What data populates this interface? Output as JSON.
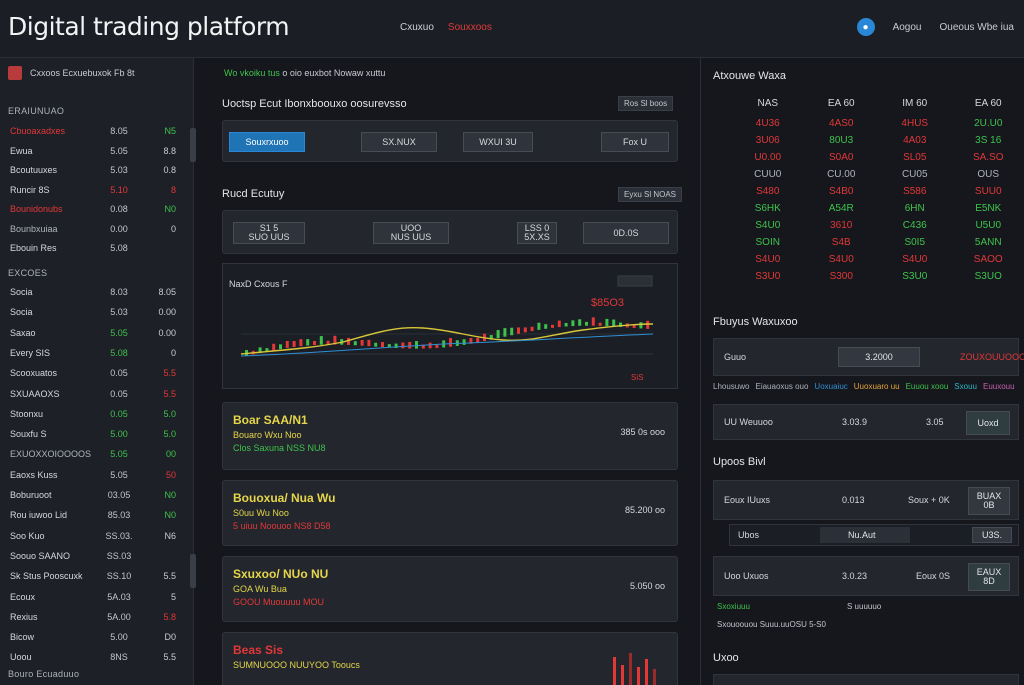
{
  "header": {
    "title": "Digital trading platform",
    "nav": [
      "Cxuxuo",
      "Souxxoos"
    ],
    "right_links": [
      "Aogou",
      "Oueous Wbe iua"
    ],
    "user_icon": "user-icon"
  },
  "sidebar": {
    "head": "Cxxoos  Ecxuebuxok  Fb  8t",
    "section1": "ERAIUNUAO",
    "rows1": [
      {
        "name": "Cbuoaxadxes",
        "val": "8.05",
        "chg": "N5",
        "name_color": "red",
        "chg_color": "green"
      },
      {
        "name": "Ewua",
        "val": "5.05",
        "chg": "8.8",
        "name_color": "",
        "chg_color": ""
      },
      {
        "name": "Bcoutuuxes",
        "val": "5.03",
        "chg": "0.8",
        "name_color": "",
        "chg_color": ""
      },
      {
        "name": "Runcir 8S",
        "val": "5.10",
        "chg": "8",
        "name_color": "",
        "chg_color": "red",
        "val_color": "red"
      },
      {
        "name": "Bounidonubs",
        "val": "0.08",
        "chg": "N0",
        "name_color": "red",
        "chg_color": "green"
      },
      {
        "name": "Bounbxuiaa",
        "val": "0.00",
        "chg": "0",
        "name_color": "muted",
        "chg_color": ""
      },
      {
        "name": "Ebouin Res",
        "val": "5.08",
        "chg": "",
        "name_color": "",
        "chg_color": ""
      }
    ],
    "section2": "EXCOES",
    "rows2": [
      {
        "name": "Socia",
        "val": "8.03",
        "chg": "8.05",
        "val_color": "",
        "chg_color": ""
      },
      {
        "name": "Socia",
        "val": "5.03",
        "chg": "0.00",
        "val_color": "",
        "chg_color": ""
      },
      {
        "name": "Saxao",
        "val": "5.05",
        "chg": "0.00",
        "val_color": "green",
        "chg_color": ""
      },
      {
        "name": "Every SIS",
        "val": "5.08",
        "chg": "0",
        "val_color": "green",
        "chg_color": ""
      },
      {
        "name": "Scooxuatos",
        "val": "0.05",
        "chg": "5.5",
        "val_color": "",
        "chg_color": "red"
      },
      {
        "name": "SXUAAOXS",
        "val": "0.05",
        "chg": "5.5",
        "val_color": "",
        "chg_color": "red"
      },
      {
        "name": "Stoonxu",
        "val": "0.05",
        "chg": "5.0",
        "val_color": "green",
        "chg_color": "green"
      },
      {
        "name": "Souxfu S",
        "val": "5.00",
        "chg": "5.0",
        "val_color": "green",
        "chg_color": "green"
      },
      {
        "name": "EXUOXXOIOOOOS",
        "val": "5.05",
        "chg": "00",
        "val_color": "green",
        "chg_color": "green",
        "name_color": "muted"
      },
      {
        "name": "Eaoxs Kuss",
        "val": "5.05",
        "chg": "50",
        "val_color": "",
        "chg_color": "red"
      },
      {
        "name": "Boburuoot",
        "val": "03.05",
        "chg": "N0",
        "val_color": "",
        "chg_color": "green"
      },
      {
        "name": "Rou iuwoo Lid",
        "val": "85.03",
        "chg": "N0",
        "val_color": "",
        "chg_color": "green"
      },
      {
        "name": "Soo Kuo",
        "val": "SS.03.",
        "chg": "N6",
        "val_color": "",
        "chg_color": ""
      },
      {
        "name": "Soouo SAANO",
        "val": "SS.03",
        "chg": "",
        "val_color": "",
        "chg_color": ""
      },
      {
        "name": "Sk Stus Pooscuxk",
        "val": "SS.10",
        "chg": "5.5",
        "val_color": "",
        "chg_color": ""
      },
      {
        "name": "Ecoux",
        "val": "5A.03",
        "chg": "5",
        "val_color": "",
        "chg_color": ""
      },
      {
        "name": "Rexius",
        "val": "5A.00",
        "chg": "5.8",
        "val_color": "",
        "chg_color": "red"
      },
      {
        "name": "Bicow",
        "val": "5.00",
        "chg": "D0",
        "val_color": "",
        "chg_color": ""
      },
      {
        "name": "Uoou",
        "val": "8NS",
        "chg": "5.5",
        "val_color": "",
        "chg_color": ""
      }
    ],
    "footer": "Bouro Ecuaduuo"
  },
  "main": {
    "ticker_green": "Wo vkoiku tus",
    "ticker_rest": "o oio euxbot Nowaw xuttu",
    "section1": {
      "title": "Uoctsp Ecut Ibonxboouxo oosurevsso",
      "pill": "Ros  Sl boos",
      "buttons": [
        "Souxrxuoo",
        "SX.NUX",
        "WXUI 3U",
        "Fox U"
      ]
    },
    "section2": {
      "title": "Rucd Ecutuy",
      "pill": "Eyxu  Sl NOAS",
      "buttons": [
        "S1 5\nSUO UUS",
        "UOO\nNUS UUS",
        "LSS 0\n5X.XS",
        "0D.0S"
      ]
    },
    "chart": {
      "title": "NaxD Cxous F",
      "price_label": "$85O3",
      "corner_label": "",
      "bottom_right": "SiS"
    },
    "orders": [
      {
        "t1": "Boar SAA/N1",
        "t2": "Bouaro Wxu Noo",
        "t3": "Clos Saxuna  NSS NU8",
        "amt": "385 0s  ooo",
        "t3_color": "green"
      },
      {
        "t1": "Bouoxua/ Nua Wu",
        "t2": "S0uu  Wu Noo",
        "t3": "5 uiuu  Noouoo NS8 D58",
        "amt": "85.200  oo",
        "t3_color": "red"
      },
      {
        "t1": "Sxuxoo/ NUo NU",
        "t2": "GOA  Wu  Bua",
        "t3": "GOOU  Muouuuu  MOU",
        "amt": "5.050  oo",
        "t3_color": "red"
      },
      {
        "t1": "Beas Sis",
        "t2": "SUMNUOOO  NUUYOO  Tooucs",
        "t3": "",
        "amt": "",
        "t3_color": "",
        "t1_color": "red"
      }
    ]
  },
  "right": {
    "market_title": "Atxouwe Waxa",
    "matrix_head": [
      "NAS",
      "EA 60",
      "IM 60",
      "EA 60"
    ],
    "matrix_rows": [
      {
        "cells": [
          "4U36",
          "4AS0",
          "4HUS",
          "2U.U0"
        ],
        "colors": [
          "red",
          "red",
          "red",
          "green"
        ]
      },
      {
        "cells": [
          "3U06",
          "80U3",
          "4A03",
          "3S 16"
        ],
        "colors": [
          "red",
          "green",
          "red",
          "green"
        ]
      },
      {
        "cells": [
          "U0.00",
          "S0A0",
          "SL05",
          "SA.SO"
        ],
        "colors": [
          "red",
          "red",
          "red",
          "red"
        ]
      },
      {
        "cells": [
          "CUU0",
          "CU.00",
          "CU05",
          "OUS"
        ],
        "colors": [
          "muted",
          "muted",
          "muted",
          "muted"
        ]
      },
      {
        "cells": [
          "S480",
          "S4B0",
          "S586",
          "SUU0"
        ],
        "colors": [
          "red",
          "red",
          "red",
          "red"
        ]
      },
      {
        "cells": [
          "S6HK",
          "A54R",
          "6HN",
          "E5NK"
        ],
        "colors": [
          "green",
          "green",
          "green",
          "green"
        ]
      },
      {
        "cells": [
          "S4U0",
          "3610",
          "C436",
          "U5U0"
        ],
        "colors": [
          "green",
          "red",
          "green",
          "green"
        ]
      },
      {
        "cells": [
          "SOIN",
          "S4B",
          "S0I5",
          "5ANN"
        ],
        "colors": [
          "green",
          "red",
          "green",
          "green"
        ]
      },
      {
        "cells": [
          "S4U0",
          "S4U0",
          "S4U0",
          "SAOO"
        ],
        "colors": [
          "red",
          "red",
          "red",
          "red"
        ]
      },
      {
        "cells": [
          "S3U0",
          "S300",
          "S3U0",
          "S3UO"
        ],
        "colors": [
          "red",
          "red",
          "green",
          "green"
        ]
      }
    ],
    "market2_title": "Fbuyus Waxuxoo",
    "market2": {
      "label": "Guuo",
      "field": "3.2000",
      "right": "ZOUXOUUOOOS"
    },
    "legend": [
      "Lhousuwo",
      "Eiauaoxus ouo",
      "Uoxuaiuc",
      "Uuoxuaro uu",
      "Euuou xoou",
      "Sxouu",
      "Euuxouu"
    ],
    "row_a": {
      "label": "UU Weuuoo",
      "value": "3.03.9",
      "mid": "3.05",
      "btn": "Uoxd"
    },
    "orders_title": "Upoos Bivl",
    "ob_rows": [
      {
        "label": "Eoux IUuxs",
        "value": "0.013",
        "mid": "Soux + 0K",
        "btn": "BUAX\n0B"
      },
      {
        "label": "Ubos",
        "value": "Nu.Aut",
        "mid": "",
        "btn": "U3S."
      },
      {
        "label": "Uoo Uxuos",
        "value": "3.0.23",
        "mid": "Eoux 0S",
        "btn": "EAUX\n8D"
      }
    ],
    "foot1_left": "Sxoxiuuu",
    "foot1_right": "S  uuuuuo",
    "foot2": "Sxouoouou  Suuu.uuOSU  5-S0",
    "bottom_title": "Uxoo"
  }
}
